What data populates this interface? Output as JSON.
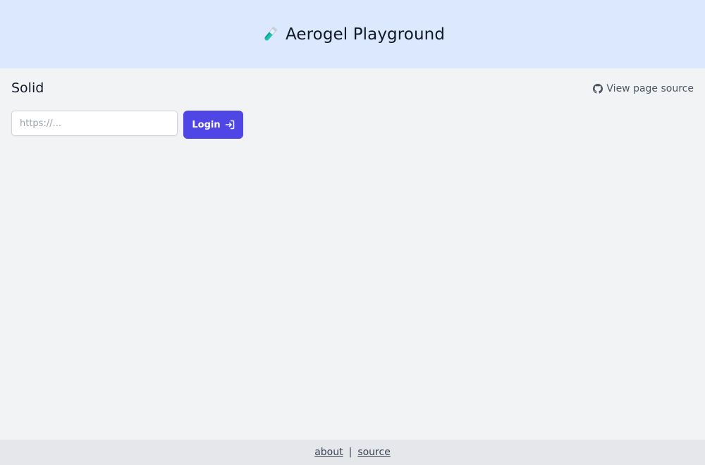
{
  "header": {
    "title": "Aerogel Playground",
    "icon": "test-tube-icon"
  },
  "main": {
    "page_title": "Solid",
    "view_source": {
      "label": "View page source",
      "icon": "github-icon"
    },
    "issuer_input": {
      "value": "",
      "placeholder": "https://..."
    },
    "login_button": {
      "label": "Login",
      "icon": "login-icon"
    }
  },
  "footer": {
    "links": [
      "about",
      "source"
    ],
    "separator": "|"
  },
  "colors": {
    "header_bg": "#dbe8fe",
    "page_bg": "#f2f3f5",
    "footer_bg": "#e5e7eb",
    "primary": "#4f46e5"
  }
}
